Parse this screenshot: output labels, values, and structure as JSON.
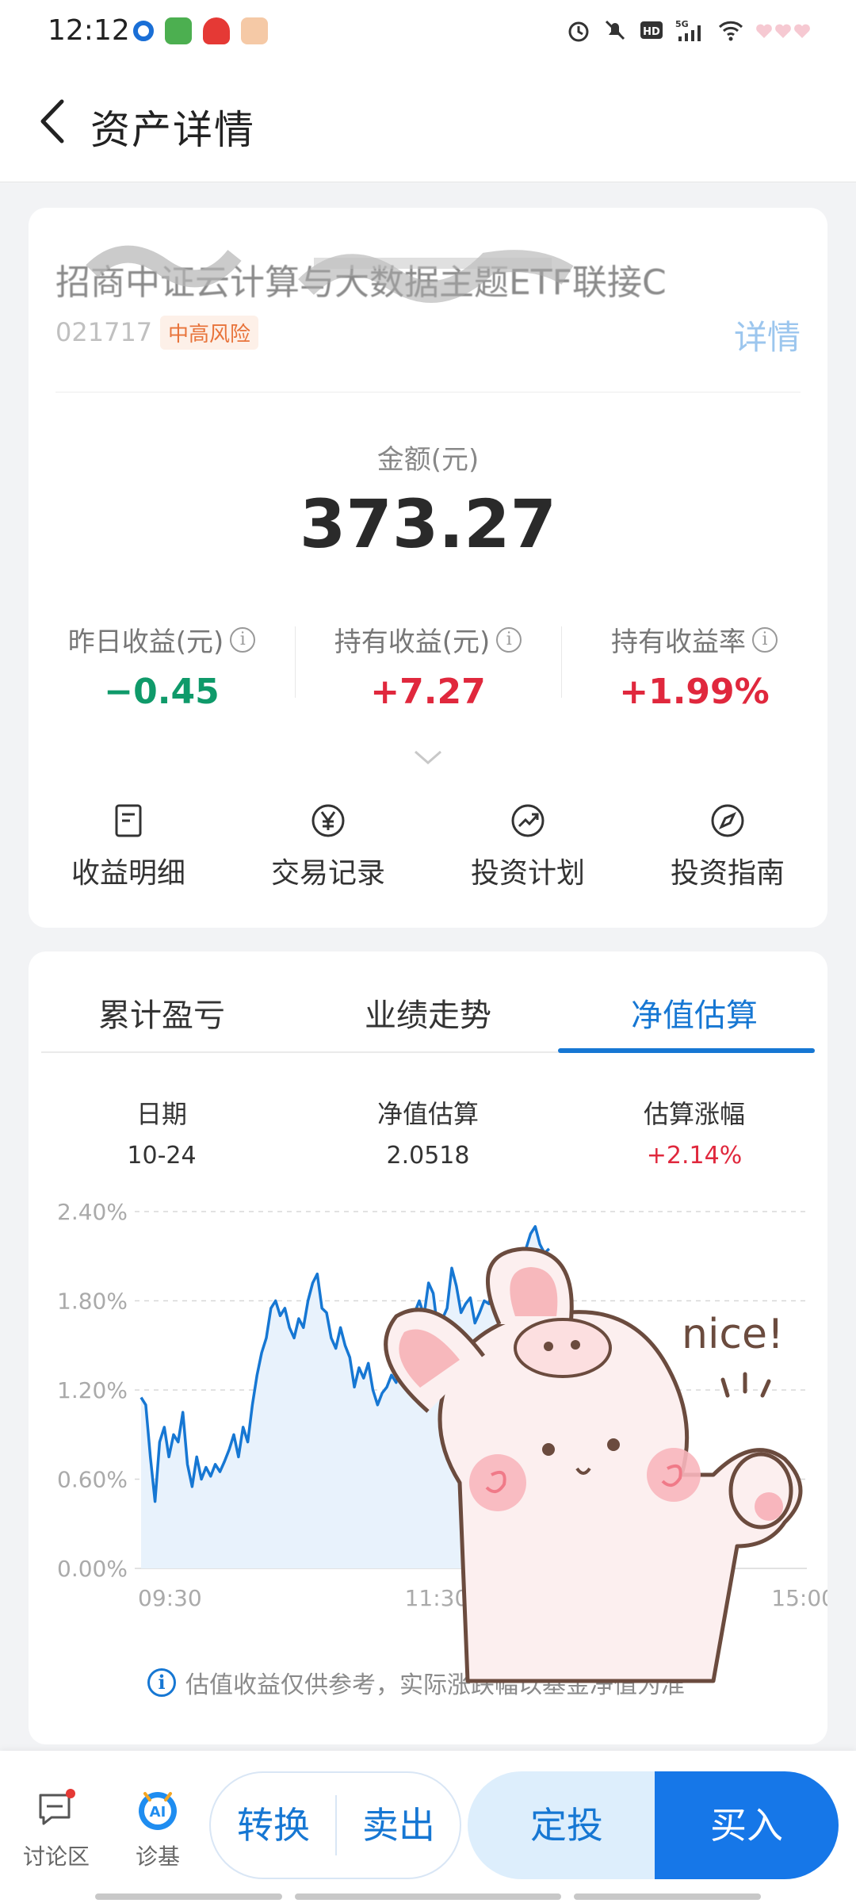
{
  "status_bar": {
    "time": "12:12",
    "icons": [
      "alarm-icon",
      "mute-icon",
      "hd-icon",
      "5g-signal-icon",
      "wifi-icon",
      "hearts-icon"
    ],
    "network": "5G"
  },
  "nav": {
    "title": "资产详情"
  },
  "fund": {
    "name": "招商中证云计算与大数据主题ETF联接C",
    "code": "021717",
    "risk": "中高风险",
    "detail_link": "详情"
  },
  "amount": {
    "label": "金额(元)",
    "value": "373.27"
  },
  "stats": [
    {
      "label": "昨日收益(元)",
      "value": "−0.45",
      "color": "#0f9a6a"
    },
    {
      "label": "持有收益(元)",
      "value": "+7.27",
      "color": "#e0283d"
    },
    {
      "label": "持有收益率",
      "value": "+1.99%",
      "color": "#e0283d"
    }
  ],
  "actions": [
    {
      "label": "收益明细",
      "icon": "document-icon"
    },
    {
      "label": "交易记录",
      "icon": "yen-icon"
    },
    {
      "label": "投资计划",
      "icon": "trend-icon"
    },
    {
      "label": "投资指南",
      "icon": "compass-icon"
    }
  ],
  "tabs": [
    {
      "label": "累计盈亏",
      "active": false
    },
    {
      "label": "业绩走势",
      "active": false
    },
    {
      "label": "净值估算",
      "active": true
    }
  ],
  "estimate": {
    "date_label": "日期",
    "date_value": "10-24",
    "nav_label": "净值估算",
    "nav_value": "2.0518",
    "change_label": "估算涨幅",
    "change_value": "+2.14%"
  },
  "chart_data": {
    "type": "area",
    "yticks": [
      "2.40%",
      "1.80%",
      "1.20%",
      "0.60%",
      "0.00%"
    ],
    "ylim": [
      0,
      2.4
    ],
    "xticks": [
      "09:30",
      "11:30/13:00",
      "15:00"
    ],
    "series": [
      {
        "values": [
          1.15,
          1.1,
          0.75,
          0.45,
          0.85,
          0.95,
          0.75,
          0.9,
          0.85,
          1.05,
          0.7,
          0.55,
          0.75,
          0.6,
          0.68,
          0.62,
          0.7,
          0.65,
          0.72,
          0.8,
          0.9,
          0.75,
          0.95,
          0.85,
          1.1,
          1.3,
          1.45,
          1.55,
          1.75,
          1.8,
          1.7,
          1.75,
          1.62,
          1.55,
          1.68,
          1.62,
          1.8,
          1.92,
          1.98,
          1.75,
          1.72,
          1.55,
          1.48,
          1.62,
          1.5,
          1.42,
          1.22,
          1.35,
          1.28,
          1.38,
          1.2,
          1.1,
          1.18,
          1.22,
          1.3,
          1.25,
          1.4,
          1.55,
          1.5,
          1.72,
          1.8,
          1.7,
          1.92,
          1.85,
          1.6,
          1.68,
          1.75,
          2.02,
          1.9,
          1.72,
          1.78,
          1.82,
          1.65,
          1.72,
          1.8,
          1.78,
          1.9,
          2.0,
          1.9,
          1.95,
          1.85,
          2.05,
          1.92,
          2.15,
          2.25,
          2.3,
          2.18,
          2.12,
          2.15
        ]
      }
    ],
    "colors": {
      "line": "#1677d3",
      "fill": "#e8f2fc",
      "grid": "#d8d8d8"
    }
  },
  "note": "估值收益仅供参考，实际涨跌幅以基金净值为准",
  "sticker_text": "nice!",
  "bottom": {
    "discuss_label": "讨论区",
    "diagnose_label": "诊基",
    "convert_label": "转换",
    "sell_label": "卖出",
    "dingtou_label": "定投",
    "buy_label": "买入"
  }
}
